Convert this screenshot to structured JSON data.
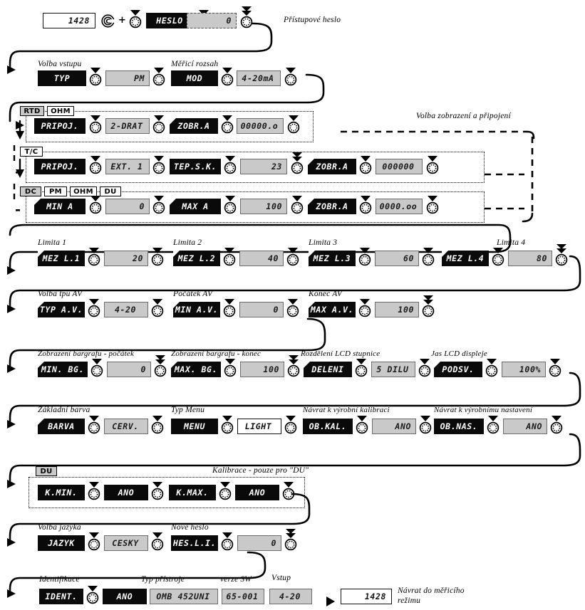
{
  "meta": {
    "title": "OMB 452UNI menu navigation diagram",
    "colors": {
      "lcd_black": "#0a0a0a",
      "lcd_gray": "#c9c9c9",
      "ink": "#000000"
    }
  },
  "captions": {
    "password": "Přístupové heslo",
    "input_select": "Volba vstupu",
    "measuring_range": "Měřicí rozsah",
    "display_connection": "Volba zobrazení a připojení",
    "limit1": "Limita 1",
    "limit2": "Limita 2",
    "limit3": "Limita 3",
    "limit4": "Limita 4",
    "av_type": "Volba tpu AV",
    "av_start": "Počátek AV",
    "av_end": "Konec AV",
    "bar_start": "Zobrazení bargrafu - počátek",
    "bar_end": "Zobrazení bargrafu - konec",
    "lcd_division": "Rozdělení LCD stupnice",
    "lcd_brightness": "Jas LCD displeje",
    "base_color": "Základní barva",
    "menu_type": "Typ Menu",
    "factory_calibration": "Návrat k výrobní kalibraci",
    "factory_settings": "Návrat k výrobnímu nastavení",
    "calibration_du": "Kalibrace - pouze pro \"DU\"",
    "language": "Volba jazyka",
    "new_password": "Nové heslo",
    "identification": "Identifikace",
    "device_type": "Typ přístroje",
    "sw_version": "verze SW",
    "input": "Vstup",
    "return_line1": "Návrat do měřicího",
    "return_line2": "režimu"
  },
  "tags": {
    "rtd": "RTD",
    "ohm": "OHM",
    "tc": "T/C",
    "dc": "DC",
    "pm": "PM",
    "ohm2": "OHM",
    "du": "DU",
    "du2": "DU"
  },
  "rows": {
    "password": {
      "value_start": "1428",
      "plus": "+",
      "menu": "HESLO",
      "entry": "0"
    },
    "input": {
      "type_label": "TYP",
      "type_value": "PM",
      "range_label": "MOD",
      "range_value": "4-20mA"
    },
    "rtd_ohm": {
      "conn_label": "PRIPOJ.",
      "conn_value": "2-DRAT",
      "disp_label": "ZOBR.A",
      "disp_value": "00000.o"
    },
    "tc": {
      "conn_label": "PRIPOJ.",
      "conn_value": "EXT. 1",
      "temp_label": "TEP.S.K.",
      "temp_value": "23",
      "disp_label": "ZOBR.A",
      "disp_value": "000000"
    },
    "dc_pm_ohm_du": {
      "min_label": "MIN A",
      "min_value": "0",
      "max_label": "MAX A",
      "max_value": "100",
      "disp_label": "ZOBR.A",
      "disp_value": "0000.oo"
    },
    "limits": [
      {
        "label": "MEZ L.1",
        "value": "20"
      },
      {
        "label": "MEZ L.2",
        "value": "40"
      },
      {
        "label": "MEZ L.3",
        "value": "60"
      },
      {
        "label": "MEZ L.4",
        "value": "80"
      }
    ],
    "analog_out": [
      {
        "label": "TYP A.V.",
        "value": "4-20"
      },
      {
        "label": "MIN A.V.",
        "value": "0"
      },
      {
        "label": "MAX A.V.",
        "value": "100"
      }
    ],
    "bargraph": [
      {
        "label": "MIN. BG.",
        "value": "0"
      },
      {
        "label": "MAX. BG.",
        "value": "100"
      },
      {
        "label": "DELENI",
        "value": "5 DILU"
      },
      {
        "label": "PODSV.",
        "value": "100%"
      }
    ],
    "appearance": [
      {
        "label": "BARVA",
        "value": "CERV."
      },
      {
        "label": "MENU",
        "value": "LIGHT"
      },
      {
        "label": "OB.KAL.",
        "value": "ANO"
      },
      {
        "label": "OB.NAS.",
        "value": "ANO"
      }
    ],
    "du_calibration": [
      {
        "label": "K.MIN.",
        "value": "ANO"
      },
      {
        "label": "K.MAX.",
        "value": "ANO"
      }
    ],
    "language": {
      "lang_label": "JAZYK",
      "lang_value": "CESKY",
      "pass_label": "HES.L.I.",
      "pass_value": "0"
    },
    "identification": {
      "ident_label": "IDENT.",
      "ident_value": "ANO",
      "device_type": "OMB 452UNI",
      "sw_version": "65-001",
      "input_value": "4-20",
      "final_value": "1428"
    }
  },
  "icons": {
    "knob": "rotary-knob-icon",
    "knob_double": "rotary-knob-double-chevron-icon",
    "c_button": "c-button-icon",
    "arrow": "arrow-right-icon"
  }
}
